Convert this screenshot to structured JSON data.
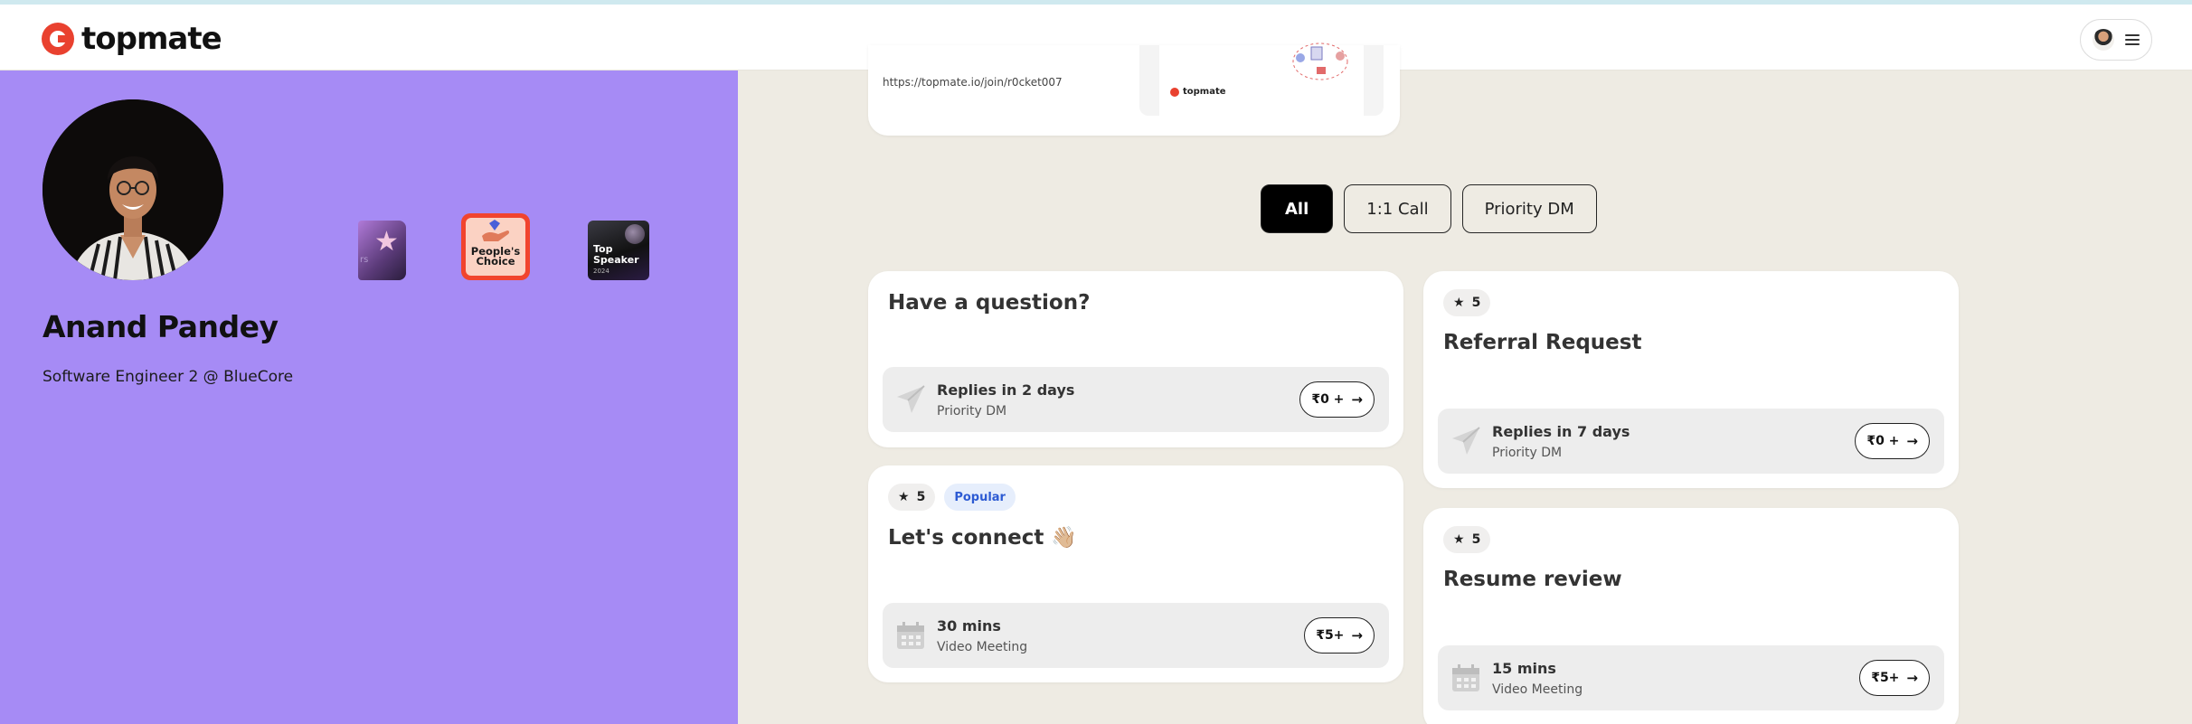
{
  "app": {
    "logo_text": "topmate"
  },
  "profile": {
    "name": "Anand Pandey",
    "headline": "Software Engineer 2 @ BlueCore",
    "badges": [
      {
        "label": "People's Choice"
      },
      {
        "label": "Top Speaker",
        "year": "2024"
      }
    ]
  },
  "share": {
    "url": "https://topmate.io/join/r0cket007",
    "preview_logo": "topmate"
  },
  "filters": {
    "all": "All",
    "call": "1:1 Call",
    "dm": "Priority DM"
  },
  "services": {
    "question": {
      "title": "Have a question?",
      "meta": "Replies in 2 days",
      "type": "Priority DM",
      "price": "₹0 +"
    },
    "connect": {
      "rating": "5",
      "popular": "Popular",
      "title": "Let's connect 👋🏼",
      "meta": "30 mins",
      "type": "Video Meeting",
      "price": "₹5+"
    },
    "referral": {
      "rating": "5",
      "title": "Referral Request",
      "meta": "Replies in 7 days",
      "type": "Priority DM",
      "price": "₹0 +"
    },
    "resume": {
      "rating": "5",
      "title": "Resume review",
      "meta": "15 mins",
      "type": "Video Meeting",
      "price": "₹5+"
    }
  },
  "colors": {
    "sidebar": "#a68bf5",
    "page_bg": "#eeebe3",
    "brand": "#e9412f",
    "popular_text": "#2d5bd3"
  }
}
